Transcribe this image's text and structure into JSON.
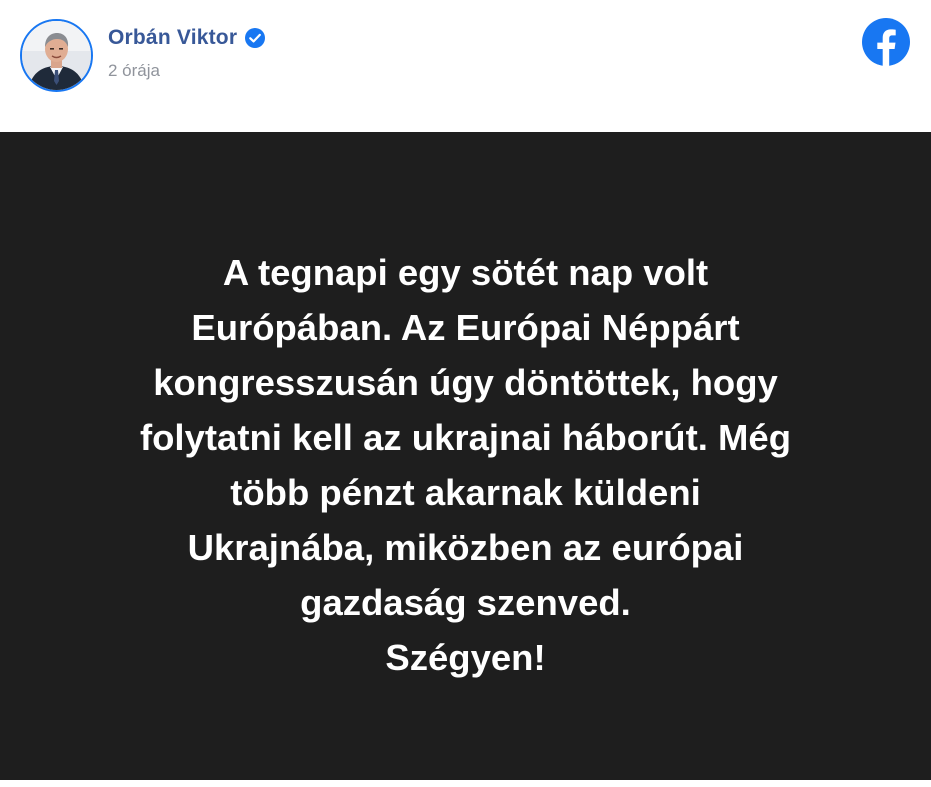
{
  "post": {
    "author": {
      "name": "Orbán Viktor",
      "verified": true,
      "avatar_icon": "profile-photo"
    },
    "timestamp": "2 órája",
    "platform_icon": "facebook-icon",
    "colors": {
      "author_name": "#385898",
      "verified_badge": "#1877f2",
      "facebook_blue": "#1877f2",
      "image_background": "#1e1e1e",
      "image_text": "#ffffff",
      "timestamp": "#90949c"
    }
  },
  "image": {
    "lines": [
      "A tegnapi egy sötét nap volt",
      "Európában. Az Európai Néppárt",
      "kongresszusán úgy döntöttek, hogy",
      "folytatni kell az ukrajnai háborút. Még",
      "több pénzt akarnak küldeni",
      "Ukrajnába, miközben az európai",
      "gazdaság szenved.",
      "Szégyen!"
    ]
  }
}
